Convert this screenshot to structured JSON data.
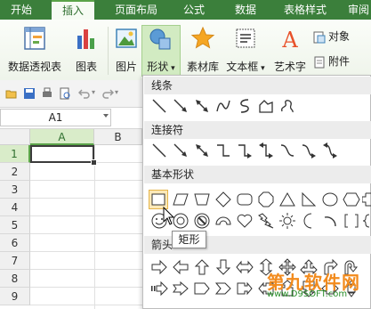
{
  "tabs": [
    "开始",
    "插入",
    "页面布局",
    "公式",
    "数据",
    "表格样式",
    "审阅"
  ],
  "active_tab": "插入",
  "ribbon": {
    "pivot_table": "数据透视表",
    "chart": "图表",
    "picture": "图片",
    "shapes": "形状",
    "material_lib": "素材库",
    "textbox": "文本框",
    "wordart": "艺术字",
    "object": "对象",
    "attachment": "附件"
  },
  "name_box": "A1",
  "columns": [
    "A",
    "B"
  ],
  "rows": [
    "1",
    "2",
    "3",
    "4",
    "5",
    "6",
    "7",
    "8",
    "9"
  ],
  "shapes_panel": {
    "lines": "线条",
    "connectors": "连接符",
    "basic_shapes": "基本形状",
    "arrows": "箭头"
  },
  "tooltip": "矩形",
  "watermark": {
    "line1": "第九软件网",
    "line2": "www.D9SOFT.com"
  },
  "colors": {
    "accent_green": "#3b7f3b",
    "selected_green": "#d2ebc2",
    "hover": "#fce9b8",
    "watermark_orange": "#f28b1d"
  }
}
